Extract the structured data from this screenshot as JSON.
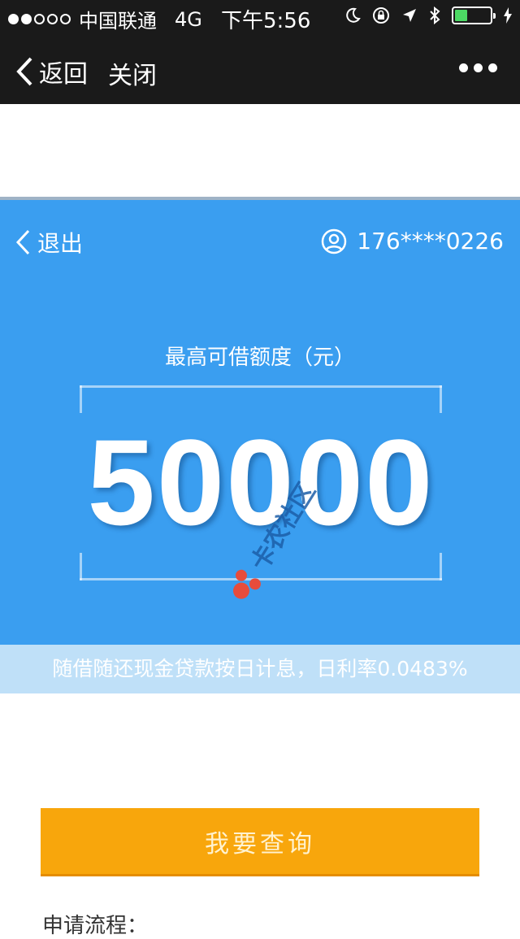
{
  "status_bar": {
    "carrier": "中国联通",
    "network": "4G",
    "time": "下午5:56",
    "battery_level": 0.35
  },
  "navbar": {
    "back_label": "返回",
    "close_label": "关闭"
  },
  "hero": {
    "exit_label": "退出",
    "phone": "176****0226",
    "credit_label": "最高可借额度（元）",
    "credit_amount": "50000",
    "watermark": "卡农社区"
  },
  "notice": {
    "text": "随借随还现金贷款按日计息，日利率0.0483%"
  },
  "actions": {
    "query_label": "我要查询"
  },
  "process": {
    "label": "申请流程："
  },
  "colors": {
    "hero_bg": "#3a9ef0",
    "button_bg": "#f8a60c",
    "bar_bg": "#1a1a1a"
  }
}
